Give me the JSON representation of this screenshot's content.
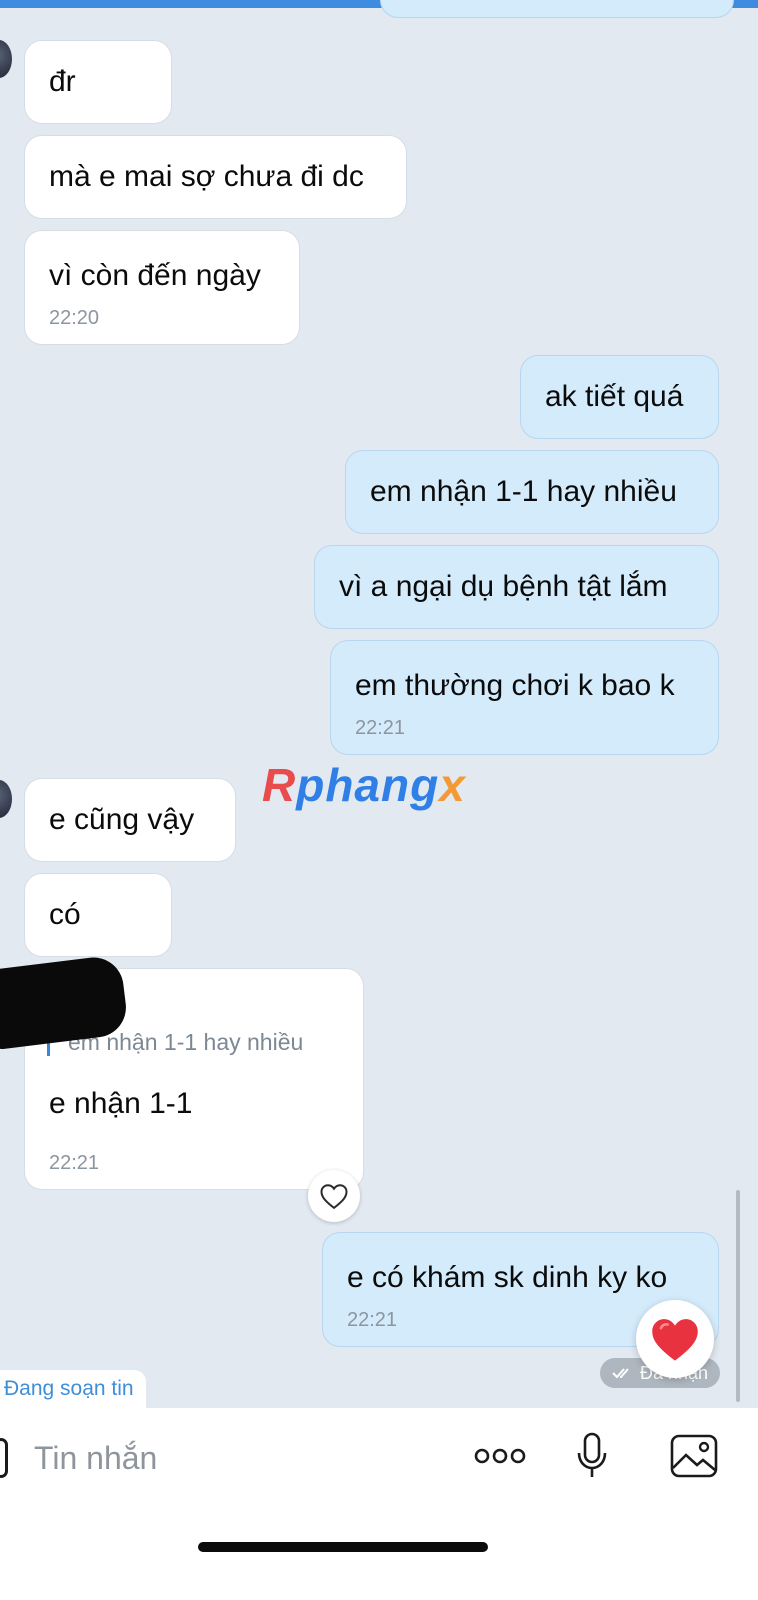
{
  "messages": [
    {
      "text": "đr"
    },
    {
      "text": "mà e mai sợ chưa đi dc"
    },
    {
      "text": "vì còn đến ngày",
      "time": "22:20"
    },
    {
      "text": "ak tiết quá"
    },
    {
      "text": "em nhận 1-1 hay nhiều"
    },
    {
      "text": "vì a ngại dụ bệnh tật lắm"
    },
    {
      "text": "em thường chơi k bao k",
      "time": "22:21"
    },
    {
      "text": "e cũng vậy"
    },
    {
      "text": "có"
    },
    {
      "quote": "em nhận 1-1 hay nhiều",
      "text": "e nhận 1-1",
      "time": "22:21"
    },
    {
      "text": "e có khám sk dinh ky ko",
      "time": "22:21"
    }
  ],
  "status": {
    "seen": "Đã nhận",
    "typing": "Đang soạn tin"
  },
  "watermark": {
    "part1": "R",
    "part2": "phang",
    "part3": "x"
  },
  "composer": {
    "placeholder": "Tin nhắn"
  },
  "icons": {
    "react": "heart-outline-icon",
    "reaction": "heart-icon",
    "more": "more-dots-icon",
    "mic": "microphone-icon",
    "image": "image-icon",
    "seen": "double-check-icon"
  },
  "colors": {
    "incoming": "#ffffff",
    "outgoing": "#d4ebfb",
    "background": "#e2e9f1",
    "accent": "#3f8ed8",
    "heart": "#e8323f"
  }
}
